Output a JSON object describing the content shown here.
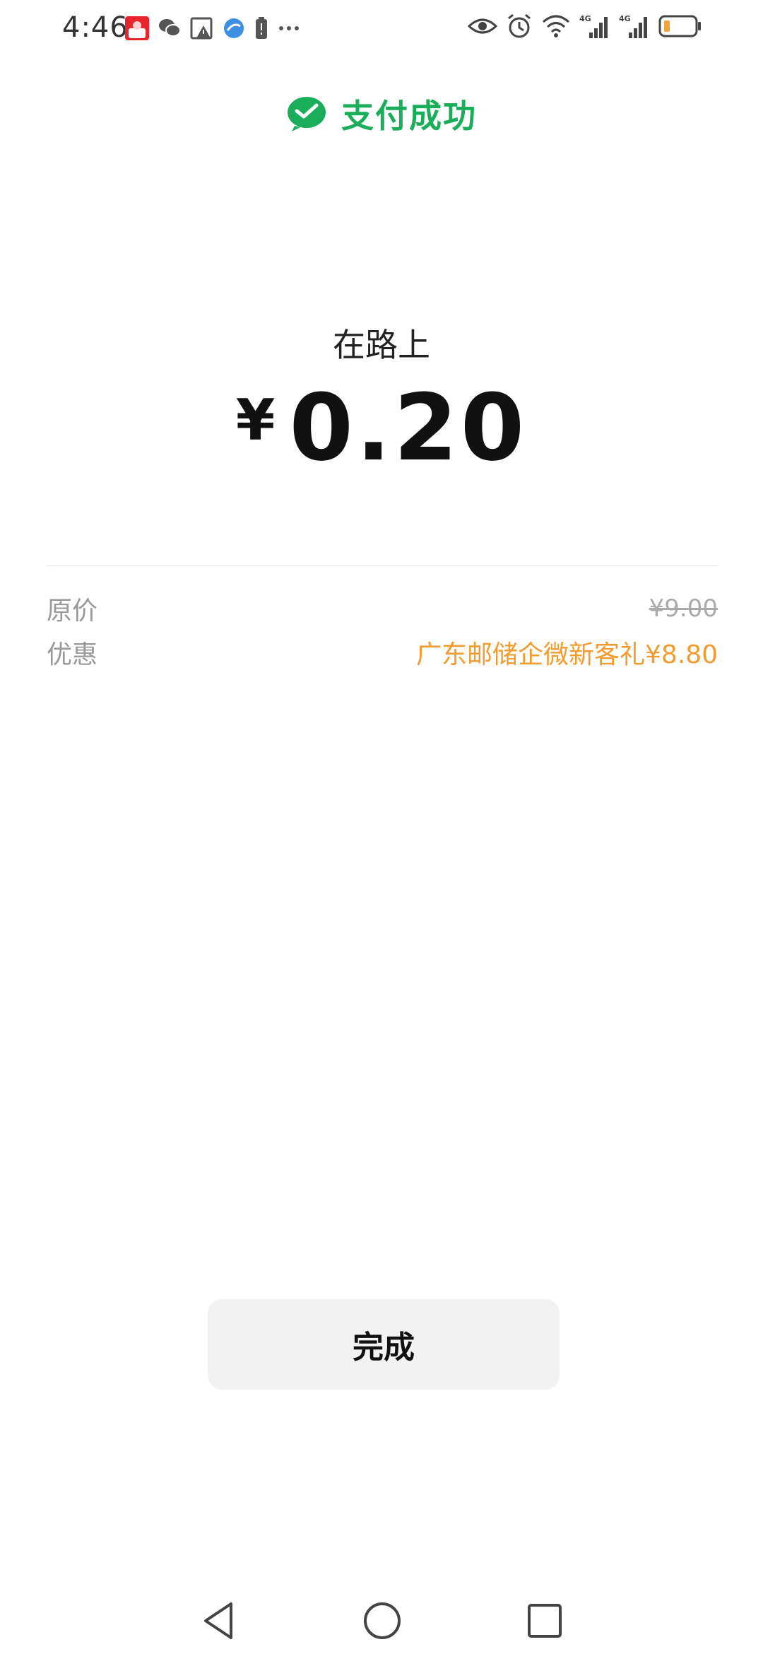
{
  "status_bar": {
    "time": "4:46",
    "left_icons": [
      "app-notification-icon",
      "wechat-icon",
      "image-warning-icon",
      "browser-icon",
      "battery-saver-icon",
      "more-dots-icon"
    ],
    "right_icons": [
      "eye-icon",
      "alarm-icon",
      "wifi-icon",
      "signal-4g-icon",
      "signal-4g-icon-2",
      "battery-icon"
    ],
    "network_label": "4G",
    "battery_color": "#f2a33a"
  },
  "header": {
    "title": "支付成功",
    "color": "#1aad5a"
  },
  "payment": {
    "merchant": "在路上",
    "currency": "¥",
    "amount": "0.20"
  },
  "details": {
    "original_label": "原价",
    "original_value": "¥9.00",
    "discount_label": "优惠",
    "discount_value": "广东邮储企微新客礼¥8.80",
    "discount_color": "#f29b2f"
  },
  "actions": {
    "done_label": "完成"
  },
  "nav": {
    "icons": [
      "back-icon",
      "home-icon",
      "recent-apps-icon"
    ]
  }
}
